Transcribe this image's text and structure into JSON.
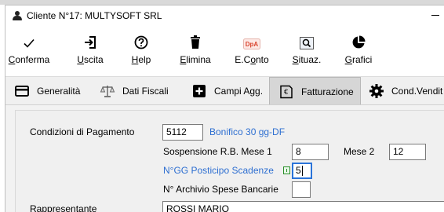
{
  "window": {
    "title": "Cliente N°17: MULTYSOFT SRL"
  },
  "toolbar": {
    "buttons": [
      {
        "pre": "",
        "u": "C",
        "post": "onferma",
        "icon": "checkmark-icon"
      },
      {
        "pre": "",
        "u": "U",
        "post": "scita",
        "icon": "exit-icon"
      },
      {
        "pre": "",
        "u": "H",
        "post": "elp",
        "icon": "help-icon"
      },
      {
        "pre": "",
        "u": "E",
        "post": "limina",
        "icon": "trash-icon"
      },
      {
        "pre": "E.C",
        "u": "o",
        "post": "nto",
        "icon": "dpa-icon"
      },
      {
        "pre": "",
        "u": "S",
        "post": "ituaz.",
        "icon": "search-icon"
      },
      {
        "pre": "",
        "u": "G",
        "post": "rafici",
        "icon": "pie-chart-icon"
      }
    ]
  },
  "tabs": [
    {
      "label": "Generalità",
      "icon": "card-icon"
    },
    {
      "label": "Dati Fiscali",
      "icon": "scale-icon"
    },
    {
      "label": "Campi Agg.",
      "icon": "plus-box-icon"
    },
    {
      "label": "Fatturazione",
      "icon": "invoice-icon",
      "active": true
    },
    {
      "label": "Cond.Vendit",
      "icon": "cog-icon"
    }
  ],
  "form": {
    "payment_conditions_label": "Condizioni di Pagamento",
    "payment_code": "5112",
    "payment_description": "Bonifico 30 gg-DF",
    "suspension_label": "Sospensione R.B.  Mese 1",
    "month1": "8",
    "month2_label": "Mese 2",
    "month2": "12",
    "deferral_label": "N°GG Posticipo Scadenze",
    "deferral_value": "5",
    "bank_fees_label": "N° Archivio Spese Bancarie",
    "bank_fees_value": "",
    "agent_label": "Rappresentante",
    "agent_value": "ROSSI MARIO"
  }
}
